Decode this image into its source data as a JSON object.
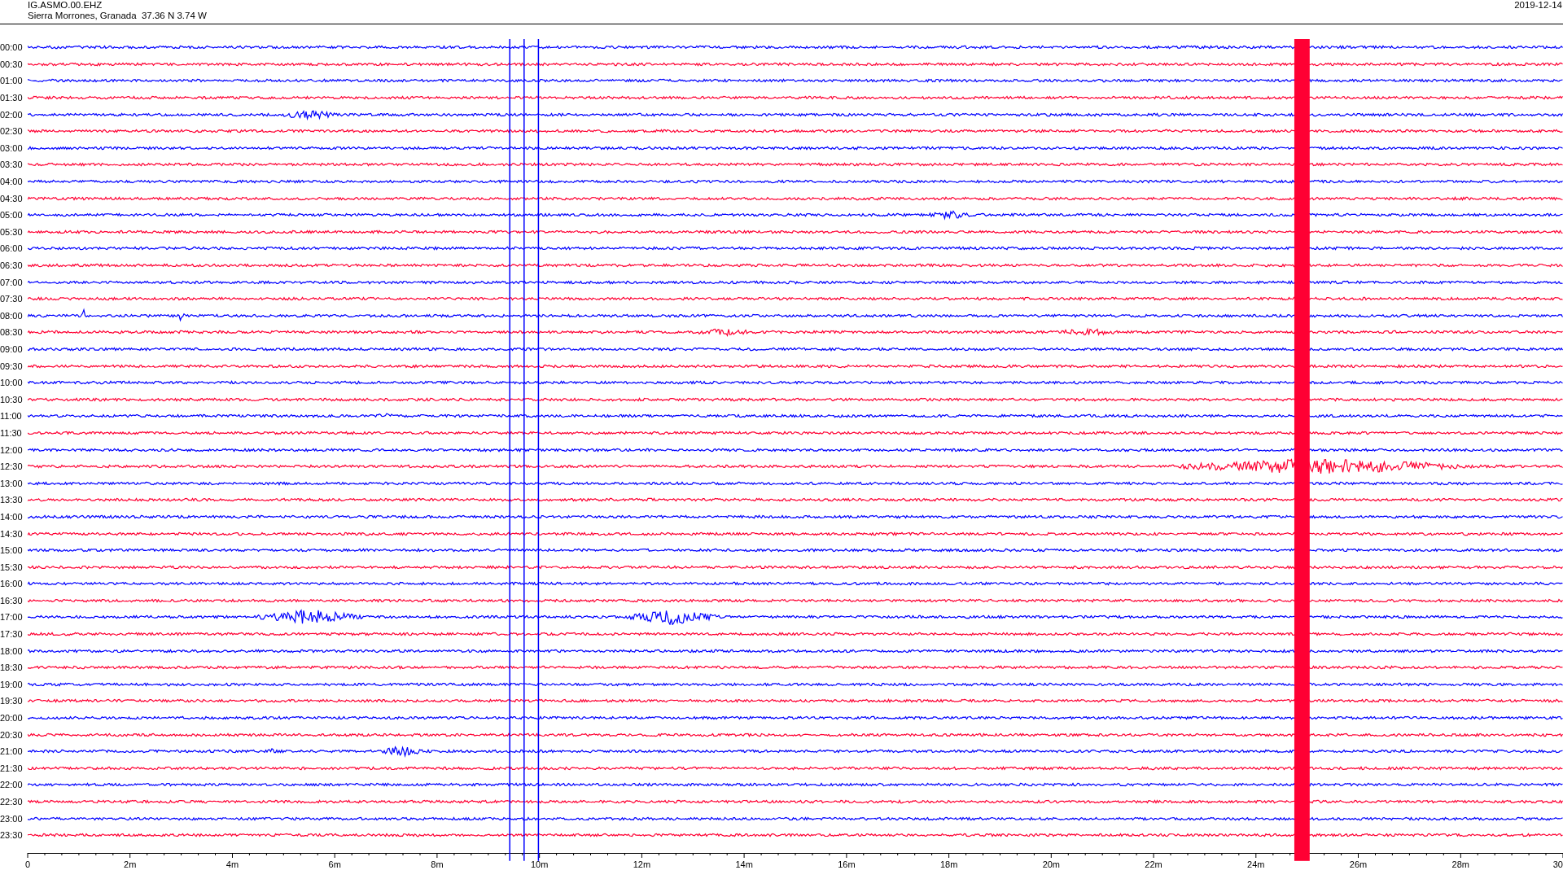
{
  "header": {
    "station": "IG.ASMO.00.EHZ",
    "location": "Sierra Morrones, Granada  37.36 N 3.74 W",
    "date": "2019-12-14"
  },
  "rows": [
    {
      "label": "00:00",
      "color": "#0000ff"
    },
    {
      "label": "00:30",
      "color": "#ff0033"
    },
    {
      "label": "01:00",
      "color": "#0000ff"
    },
    {
      "label": "01:30",
      "color": "#ff0033"
    },
    {
      "label": "02:00",
      "color": "#0000ff"
    },
    {
      "label": "02:30",
      "color": "#ff0033"
    },
    {
      "label": "03:00",
      "color": "#0000ff"
    },
    {
      "label": "03:30",
      "color": "#ff0033"
    },
    {
      "label": "04:00",
      "color": "#0000ff"
    },
    {
      "label": "04:30",
      "color": "#ff0033"
    },
    {
      "label": "05:00",
      "color": "#0000ff"
    },
    {
      "label": "05:30",
      "color": "#ff0033"
    },
    {
      "label": "06:00",
      "color": "#0000ff"
    },
    {
      "label": "06:30",
      "color": "#ff0033"
    },
    {
      "label": "07:00",
      "color": "#0000ff"
    },
    {
      "label": "07:30",
      "color": "#ff0033"
    },
    {
      "label": "08:00",
      "color": "#0000ff"
    },
    {
      "label": "08:30",
      "color": "#ff0033"
    },
    {
      "label": "09:00",
      "color": "#0000ff"
    },
    {
      "label": "09:30",
      "color": "#ff0033"
    },
    {
      "label": "10:00",
      "color": "#0000ff"
    },
    {
      "label": "10:30",
      "color": "#ff0033"
    },
    {
      "label": "11:00",
      "color": "#0000ff"
    },
    {
      "label": "11:30",
      "color": "#ff0033"
    },
    {
      "label": "12:00",
      "color": "#0000ff"
    },
    {
      "label": "12:30",
      "color": "#ff0033"
    },
    {
      "label": "13:00",
      "color": "#0000ff"
    },
    {
      "label": "13:30",
      "color": "#ff0033"
    },
    {
      "label": "14:00",
      "color": "#0000ff"
    },
    {
      "label": "14:30",
      "color": "#ff0033"
    },
    {
      "label": "15:00",
      "color": "#0000ff"
    },
    {
      "label": "15:30",
      "color": "#ff0033"
    },
    {
      "label": "16:00",
      "color": "#0000ff"
    },
    {
      "label": "16:30",
      "color": "#ff0033"
    },
    {
      "label": "17:00",
      "color": "#0000ff"
    },
    {
      "label": "17:30",
      "color": "#ff0033"
    },
    {
      "label": "18:00",
      "color": "#0000ff"
    },
    {
      "label": "18:30",
      "color": "#ff0033"
    },
    {
      "label": "19:00",
      "color": "#0000ff"
    },
    {
      "label": "19:30",
      "color": "#ff0033"
    },
    {
      "label": "20:00",
      "color": "#0000ff"
    },
    {
      "label": "20:30",
      "color": "#ff0033"
    },
    {
      "label": "21:00",
      "color": "#0000ff"
    },
    {
      "label": "21:30",
      "color": "#ff0033"
    },
    {
      "label": "22:00",
      "color": "#0000ff"
    },
    {
      "label": "22:30",
      "color": "#ff0033"
    },
    {
      "label": "23:00",
      "color": "#0000ff"
    },
    {
      "label": "23:30",
      "color": "#ff0033"
    }
  ],
  "axis": {
    "labels": [
      "0",
      "2m",
      "4m",
      "6m",
      "8m",
      "10m",
      "12m",
      "14m",
      "16m",
      "18m",
      "20m",
      "22m",
      "24m",
      "26m",
      "28m",
      "30"
    ]
  }
}
